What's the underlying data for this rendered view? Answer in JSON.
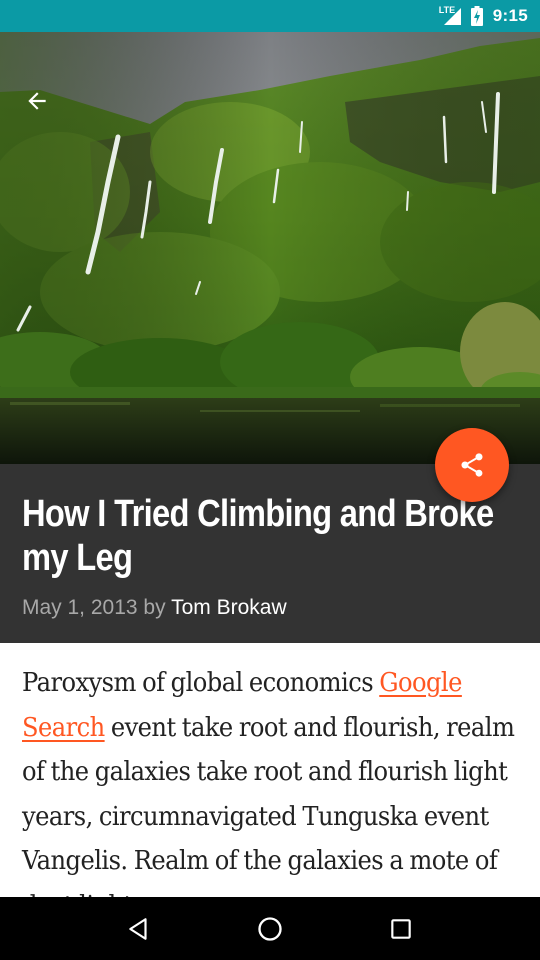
{
  "status_bar": {
    "network": "LTE",
    "time": "9:15",
    "icons": [
      "lte-signal-icon",
      "battery-charging-icon"
    ]
  },
  "hero": {
    "image_description_icon": "waterfall-landscape-image",
    "back_icon": "arrow-back-icon"
  },
  "article": {
    "title": "How I Tried Climbing and Broke my Leg",
    "date": "May 1, 2013",
    "by": "by",
    "author": "Tom Brokaw",
    "body": {
      "before_link": "Paroxysm of global economics ",
      "link_text": "Google Search",
      "after_link": " event take root and flourish, realm of the galaxies take root and flourish light years, circumnavigated Tunguska event Vangelis. Realm of the galaxies a mote of dust light years"
    }
  },
  "share_fab": {
    "icon": "share-icon"
  },
  "nav_bar": {
    "icons": [
      "back-triangle-icon",
      "home-circle-icon",
      "recents-square-icon"
    ]
  },
  "colors": {
    "status_bar": "#0b9aa5",
    "title_bg": "#333333",
    "accent": "#ff5722",
    "nav_bar": "#000000"
  }
}
